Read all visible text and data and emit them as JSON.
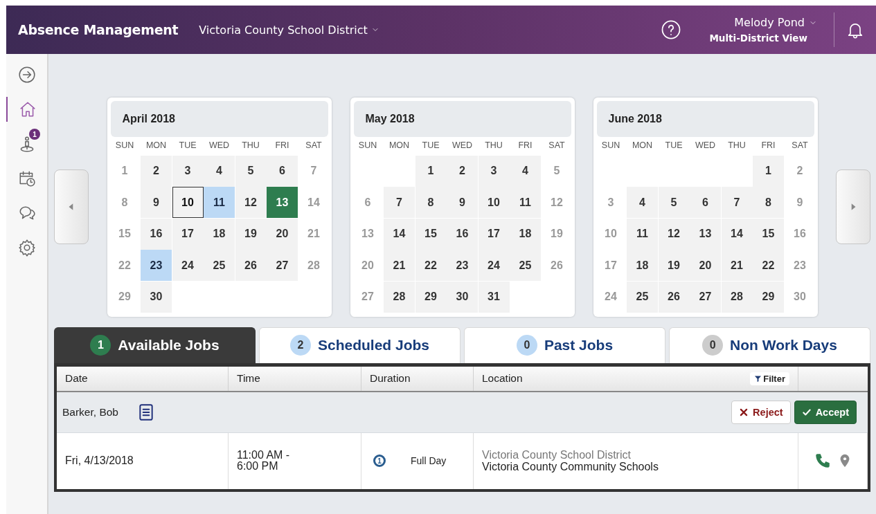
{
  "header": {
    "title": "Absence Management",
    "district": "Victoria County School District",
    "user": "Melody Pond",
    "view": "Multi-District View"
  },
  "sidebar": {
    "items": [
      {
        "selected": false
      },
      {
        "selected": true
      },
      {
        "selected": false,
        "badge": "1"
      },
      {
        "selected": false
      },
      {
        "selected": false
      },
      {
        "selected": false
      }
    ]
  },
  "calendars": [
    {
      "title": "April 2018",
      "weekdays": [
        "SUN",
        "MON",
        "TUE",
        "WED",
        "THU",
        "FRI",
        "SAT"
      ],
      "weeks": [
        [
          {
            "day": "1",
            "kind": "weekend"
          },
          {
            "day": "2",
            "kind": "weekday"
          },
          {
            "day": "3",
            "kind": "weekday"
          },
          {
            "day": "4",
            "kind": "weekday"
          },
          {
            "day": "5",
            "kind": "weekday"
          },
          {
            "day": "6",
            "kind": "weekday"
          },
          {
            "day": "7",
            "kind": "weekend"
          }
        ],
        [
          {
            "day": "8",
            "kind": "weekend"
          },
          {
            "day": "9",
            "kind": "weekday"
          },
          {
            "day": "10",
            "kind": "today"
          },
          {
            "day": "11",
            "kind": "scheduled"
          },
          {
            "day": "12",
            "kind": "weekday"
          },
          {
            "day": "13",
            "kind": "available"
          },
          {
            "day": "14",
            "kind": "weekend"
          }
        ],
        [
          {
            "day": "15",
            "kind": "weekend"
          },
          {
            "day": "16",
            "kind": "weekday"
          },
          {
            "day": "17",
            "kind": "weekday"
          },
          {
            "day": "18",
            "kind": "weekday"
          },
          {
            "day": "19",
            "kind": "weekday"
          },
          {
            "day": "20",
            "kind": "weekday"
          },
          {
            "day": "21",
            "kind": "weekend"
          }
        ],
        [
          {
            "day": "22",
            "kind": "weekend"
          },
          {
            "day": "23",
            "kind": "scheduled"
          },
          {
            "day": "24",
            "kind": "weekday"
          },
          {
            "day": "25",
            "kind": "weekday"
          },
          {
            "day": "26",
            "kind": "weekday"
          },
          {
            "day": "27",
            "kind": "weekday"
          },
          {
            "day": "28",
            "kind": "weekend"
          }
        ],
        [
          {
            "day": "29",
            "kind": "weekend"
          },
          {
            "day": "30",
            "kind": "weekday"
          },
          {
            "kind": "blank"
          },
          {
            "kind": "blank"
          },
          {
            "kind": "blank"
          },
          {
            "kind": "blank"
          },
          {
            "kind": "blank"
          }
        ]
      ]
    },
    {
      "title": "May 2018",
      "weekdays": [
        "SUN",
        "MON",
        "TUE",
        "WED",
        "THU",
        "FRI",
        "SAT"
      ],
      "weeks": [
        [
          {
            "kind": "blank"
          },
          {
            "kind": "blank"
          },
          {
            "day": "1",
            "kind": "weekday"
          },
          {
            "day": "2",
            "kind": "weekday"
          },
          {
            "day": "3",
            "kind": "weekday"
          },
          {
            "day": "4",
            "kind": "weekday"
          },
          {
            "day": "5",
            "kind": "weekend"
          }
        ],
        [
          {
            "day": "6",
            "kind": "weekend"
          },
          {
            "day": "7",
            "kind": "weekday"
          },
          {
            "day": "8",
            "kind": "weekday"
          },
          {
            "day": "9",
            "kind": "weekday"
          },
          {
            "day": "10",
            "kind": "weekday"
          },
          {
            "day": "11",
            "kind": "weekday"
          },
          {
            "day": "12",
            "kind": "weekend"
          }
        ],
        [
          {
            "day": "13",
            "kind": "weekend"
          },
          {
            "day": "14",
            "kind": "weekday"
          },
          {
            "day": "15",
            "kind": "weekday"
          },
          {
            "day": "16",
            "kind": "weekday"
          },
          {
            "day": "17",
            "kind": "weekday"
          },
          {
            "day": "18",
            "kind": "weekday"
          },
          {
            "day": "19",
            "kind": "weekend"
          }
        ],
        [
          {
            "day": "20",
            "kind": "weekend"
          },
          {
            "day": "21",
            "kind": "weekday"
          },
          {
            "day": "22",
            "kind": "weekday"
          },
          {
            "day": "23",
            "kind": "weekday"
          },
          {
            "day": "24",
            "kind": "weekday"
          },
          {
            "day": "25",
            "kind": "weekday"
          },
          {
            "day": "26",
            "kind": "weekend"
          }
        ],
        [
          {
            "day": "27",
            "kind": "weekend"
          },
          {
            "day": "28",
            "kind": "weekday"
          },
          {
            "day": "29",
            "kind": "weekday"
          },
          {
            "day": "30",
            "kind": "weekday"
          },
          {
            "day": "31",
            "kind": "weekday"
          },
          {
            "kind": "blank"
          },
          {
            "kind": "blank"
          }
        ]
      ]
    },
    {
      "title": "June 2018",
      "weekdays": [
        "SUN",
        "MON",
        "TUE",
        "WED",
        "THU",
        "FRI",
        "SAT"
      ],
      "weeks": [
        [
          {
            "kind": "blank"
          },
          {
            "kind": "blank"
          },
          {
            "kind": "blank"
          },
          {
            "kind": "blank"
          },
          {
            "kind": "blank"
          },
          {
            "day": "1",
            "kind": "weekday"
          },
          {
            "day": "2",
            "kind": "weekend"
          }
        ],
        [
          {
            "day": "3",
            "kind": "weekend"
          },
          {
            "day": "4",
            "kind": "weekday"
          },
          {
            "day": "5",
            "kind": "weekday"
          },
          {
            "day": "6",
            "kind": "weekday"
          },
          {
            "day": "7",
            "kind": "weekday"
          },
          {
            "day": "8",
            "kind": "weekday"
          },
          {
            "day": "9",
            "kind": "weekend"
          }
        ],
        [
          {
            "day": "10",
            "kind": "weekend"
          },
          {
            "day": "11",
            "kind": "weekday"
          },
          {
            "day": "12",
            "kind": "weekday"
          },
          {
            "day": "13",
            "kind": "weekday"
          },
          {
            "day": "14",
            "kind": "weekday"
          },
          {
            "day": "15",
            "kind": "weekday"
          },
          {
            "day": "16",
            "kind": "weekend"
          }
        ],
        [
          {
            "day": "17",
            "kind": "weekend"
          },
          {
            "day": "18",
            "kind": "weekday"
          },
          {
            "day": "19",
            "kind": "weekday"
          },
          {
            "day": "20",
            "kind": "weekday"
          },
          {
            "day": "21",
            "kind": "weekday"
          },
          {
            "day": "22",
            "kind": "weekday"
          },
          {
            "day": "23",
            "kind": "weekend"
          }
        ],
        [
          {
            "day": "24",
            "kind": "weekend"
          },
          {
            "day": "25",
            "kind": "weekday"
          },
          {
            "day": "26",
            "kind": "weekday"
          },
          {
            "day": "27",
            "kind": "weekday"
          },
          {
            "day": "28",
            "kind": "weekday"
          },
          {
            "day": "29",
            "kind": "weekday"
          },
          {
            "day": "30",
            "kind": "weekend"
          }
        ]
      ]
    }
  ],
  "tabs": [
    {
      "count": "1",
      "label": "Available Jobs",
      "selected": true,
      "color": "#2e7d4f"
    },
    {
      "count": "2",
      "label": "Scheduled Jobs",
      "selected": false,
      "color": "#bcd9f5"
    },
    {
      "count": "0",
      "label": "Past Jobs",
      "selected": false,
      "color": "#bcd9f5"
    },
    {
      "count": "0",
      "label": "Non Work Days",
      "selected": false,
      "color": "#cccccc"
    }
  ],
  "table": {
    "columns": [
      "Date",
      "Time",
      "Duration",
      "Location"
    ],
    "filter": "Filter",
    "group": {
      "name": "Barker, Bob",
      "reject": "Reject",
      "accept": "Accept"
    },
    "rows": [
      {
        "date": "Fri, 4/13/2018",
        "time": [
          "11:00 AM -",
          "6:00 PM"
        ],
        "duration_count": "1",
        "duration": "Full Day",
        "district": "Victoria County School District",
        "school": "Victoria County Community Schools"
      }
    ]
  }
}
